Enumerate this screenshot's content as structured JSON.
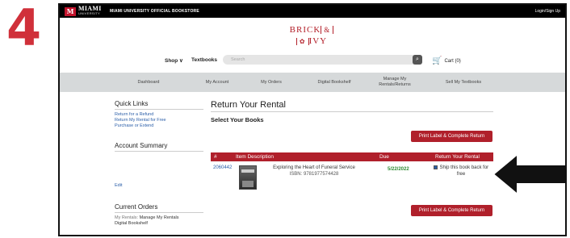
{
  "step": {
    "number": "4"
  },
  "topbar": {
    "logo_big": "MIAMI",
    "logo_small": "UNIVERSITY",
    "store_title": "MIAMI UNIVERSITY OFFICIAL BOOKSTORE",
    "login": "Login/Sign Up"
  },
  "brand": {
    "line1": "BRICK",
    "amp": "&",
    "line2": "IVY"
  },
  "nav": {
    "shop": "Shop ∨",
    "textbooks": "Textbooks",
    "search_placeholder": "Search",
    "cart": "Cart (0)"
  },
  "subnav": [
    {
      "label": "Dashboard"
    },
    {
      "label": "My Account"
    },
    {
      "label": "My Orders"
    },
    {
      "label": "Digital Bookshelf"
    },
    {
      "label": "Manage My Rentals/Returns"
    },
    {
      "label": "Sell My Textbooks"
    }
  ],
  "sidebar": {
    "quick_links_title": "Quick Links",
    "links": [
      "Return for a Refund",
      "Return My Rental for Free",
      "Purchase or Extend"
    ],
    "account_summary_title": "Account Summary",
    "edit": "Edit",
    "current_orders_title": "Current Orders",
    "orders_prefix": "My Rentals:",
    "orders_link": "Manage My Rentals",
    "digital": "Digital Bookshelf"
  },
  "main": {
    "title": "Return Your Rental",
    "select_label": "Select Your Books",
    "action_button": "Print Label & Complete Return"
  },
  "table": {
    "headers": [
      "#",
      "Item Description",
      "Due",
      "Return Your Rental"
    ],
    "rows": [
      {
        "id": "2060442",
        "title": "Exploring the Heart of Funeral Service",
        "isbn": "ISBN: 9781977574428",
        "due": "5/22/2022",
        "ship_label": "Ship this book back for free"
      }
    ]
  },
  "colors": {
    "brand_red": "#b0202b",
    "step_red": "#d0303a",
    "due_green": "#2e8b32",
    "link_blue": "#2a5ea8"
  }
}
